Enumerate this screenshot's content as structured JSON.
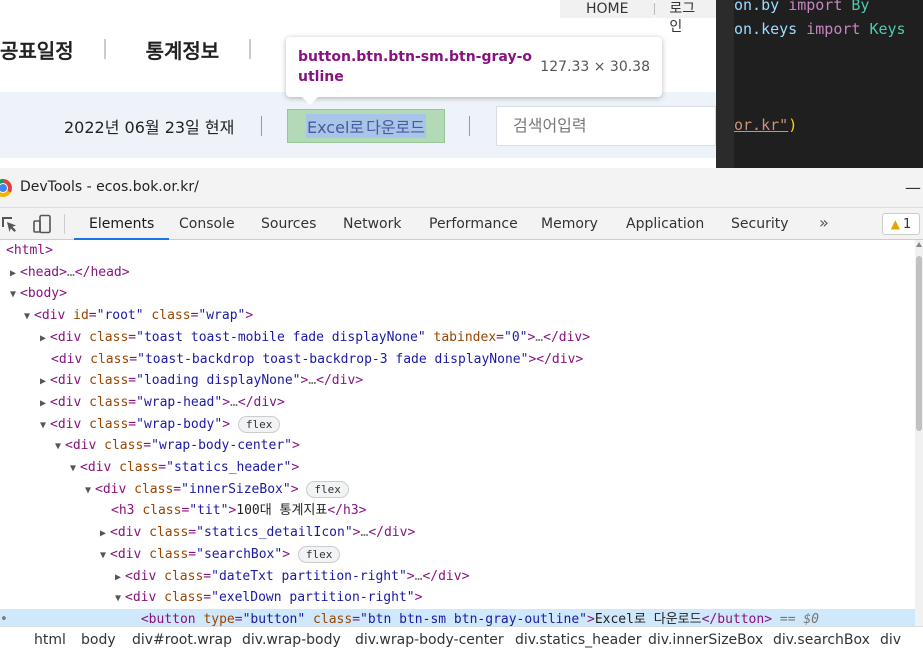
{
  "webpage": {
    "topnav": {
      "home": "HOME",
      "login": "로그인"
    },
    "menu": [
      "공표일정",
      "통계정보"
    ],
    "date_text": "2022년 06월 23일 현재",
    "excel_button": {
      "label_part1": "Excel로",
      "label_part2": " 다운로드"
    },
    "search_placeholder": "검색어입력"
  },
  "tooltip": {
    "selector": "button.btn.btn-sm.btn-gray-outline",
    "dimensions": "127.33 × 30.38"
  },
  "editor": {
    "line1": {
      "a": "on.by ",
      "kw": "import",
      "ty": " By"
    },
    "line2": {
      "a": "on.keys ",
      "kw": "import",
      "ty": " Keys"
    },
    "line3": {
      "str": "or.kr\"",
      "br": ")"
    }
  },
  "devtools": {
    "title": "DevTools - ecos.bok.or.kr/",
    "tabs": [
      "Elements",
      "Console",
      "Sources",
      "Network",
      "Performance",
      "Memory",
      "Application",
      "Security"
    ],
    "more_tabs": "»",
    "warnings": "1",
    "dom": [
      {
        "open": "<",
        "tag": "html",
        "close": ">"
      },
      {
        "tag": "head",
        "collapsed": "…"
      },
      {
        "tag": "body"
      },
      {
        "id_attr": "id",
        "id_val": "root",
        "class_val": "wrap"
      },
      {
        "class_val": "toast toast-mobile fade displayNone",
        "extra_attr": "tabindex",
        "extra_val": "0"
      },
      {
        "class_val": "toast-backdrop toast-backdrop-3 fade displayNone"
      },
      {
        "class_val": "loading displayNone"
      },
      {
        "class_val": "wrap-head"
      },
      {
        "class_val": "wrap-body",
        "badge": "flex"
      },
      {
        "class_val": "wrap-body-center"
      },
      {
        "class_val": "statics_header"
      },
      {
        "class_val": "innerSizeBox",
        "badge": "flex"
      },
      {
        "h3_class": "tit",
        "h3_text": "100대 통계지표"
      },
      {
        "class_val": "statics_detailIcon"
      },
      {
        "class_val": "searchBox",
        "badge": "flex"
      },
      {
        "class_val": "dateTxt partition-right"
      },
      {
        "class_val": "exelDown partition-right"
      },
      {
        "btn_type": "button",
        "btn_class": "btn btn-sm btn-gray-outline",
        "btn_text": "Excel로 다운로드",
        "eq": " == $0"
      }
    ],
    "breadcrumbs": [
      "html",
      "body",
      "div#root.wrap",
      "div.wrap-body",
      "div.wrap-body-center",
      "div.statics_header",
      "div.innerSizeBox",
      "div.searchBox",
      "div"
    ]
  }
}
